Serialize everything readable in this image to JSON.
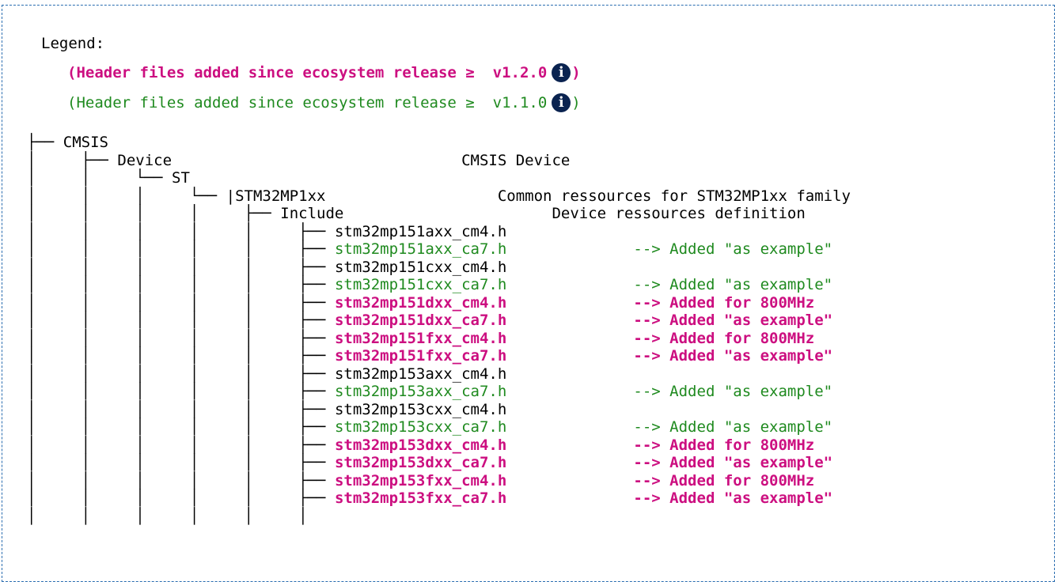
{
  "legend": {
    "title": "Legend:",
    "v120_text": "(Header files added since ecosystem release ≥  v1.2.0",
    "v120_close": ")",
    "v110_text": "(Header files added since ecosystem release ≥  v1.1.0",
    "v110_close": ")",
    "info_glyph": "i",
    "info_icon_name": "info-icon",
    "colors": {
      "v120": "#cc0f80",
      "v110": "#1f8a1f",
      "frame": "#2a6db0",
      "info_icon": "#0a2350"
    }
  },
  "tree": {
    "rows": [
      {
        "prefix": "├── ",
        "name": "CMSIS",
        "desc": "",
        "style": "normal"
      },
      {
        "prefix": "│     ├── ",
        "name": "Device",
        "desc": "                                CMSIS Device",
        "style": "normal"
      },
      {
        "prefix": "│     │     └── ",
        "name": "ST",
        "desc": "",
        "style": "normal"
      },
      {
        "prefix": "│     │     │     └── ",
        "name": "|STM32MP1xx",
        "desc": "                   Common ressources for STM32MP1xx family",
        "style": "normal"
      },
      {
        "prefix": "│     │     │     │     ├── ",
        "name": "Include",
        "desc": "                       Device ressources definition",
        "style": "normal"
      },
      {
        "prefix": "│     │     │     │     │     ├── ",
        "name": "stm32mp151axx_cm4.h",
        "desc": "",
        "style": "normal"
      },
      {
        "prefix": "│     │     │     │     │     ├── ",
        "name": "stm32mp151axx_ca7.h",
        "desc": "              --> Added \"as example\"",
        "style": "green"
      },
      {
        "prefix": "│     │     │     │     │     ├── ",
        "name": "stm32mp151cxx_cm4.h",
        "desc": "",
        "style": "normal"
      },
      {
        "prefix": "│     │     │     │     │     ├── ",
        "name": "stm32mp151cxx_ca7.h",
        "desc": "              --> Added \"as example\"",
        "style": "green"
      },
      {
        "prefix": "│     │     │     │     │     ├── ",
        "name": "stm32mp151dxx_cm4.h",
        "desc": "              --> Added for 800MHz",
        "style": "magenta"
      },
      {
        "prefix": "│     │     │     │     │     ├── ",
        "name": "stm32mp151dxx_ca7.h",
        "desc": "              --> Added \"as example\"",
        "style": "magenta"
      },
      {
        "prefix": "│     │     │     │     │     ├── ",
        "name": "stm32mp151fxx_cm4.h",
        "desc": "              --> Added for 800MHz",
        "style": "magenta"
      },
      {
        "prefix": "│     │     │     │     │     ├── ",
        "name": "stm32mp151fxx_ca7.h",
        "desc": "              --> Added \"as example\"",
        "style": "magenta"
      },
      {
        "prefix": "│     │     │     │     │     ├── ",
        "name": "stm32mp153axx_cm4.h",
        "desc": "",
        "style": "normal"
      },
      {
        "prefix": "│     │     │     │     │     ├── ",
        "name": "stm32mp153axx_ca7.h",
        "desc": "              --> Added \"as example\"",
        "style": "green"
      },
      {
        "prefix": "│     │     │     │     │     ├── ",
        "name": "stm32mp153cxx_cm4.h",
        "desc": "",
        "style": "normal"
      },
      {
        "prefix": "│     │     │     │     │     ├── ",
        "name": "stm32mp153cxx_ca7.h",
        "desc": "              --> Added \"as example\"",
        "style": "green"
      },
      {
        "prefix": "│     │     │     │     │     ├── ",
        "name": "stm32mp153dxx_cm4.h",
        "desc": "              --> Added for 800MHz",
        "style": "magenta"
      },
      {
        "prefix": "│     │     │     │     │     ├── ",
        "name": "stm32mp153dxx_ca7.h",
        "desc": "              --> Added \"as example\"",
        "style": "magenta"
      },
      {
        "prefix": "│     │     │     │     │     ├── ",
        "name": "stm32mp153fxx_cm4.h",
        "desc": "              --> Added for 800MHz",
        "style": "magenta"
      },
      {
        "prefix": "│     │     │     │     │     ├── ",
        "name": "stm32mp153fxx_ca7.h",
        "desc": "              --> Added \"as example\"",
        "style": "magenta"
      },
      {
        "prefix": "│     │     │     │     │     │",
        "name": "",
        "desc": "",
        "style": "normal"
      }
    ]
  }
}
